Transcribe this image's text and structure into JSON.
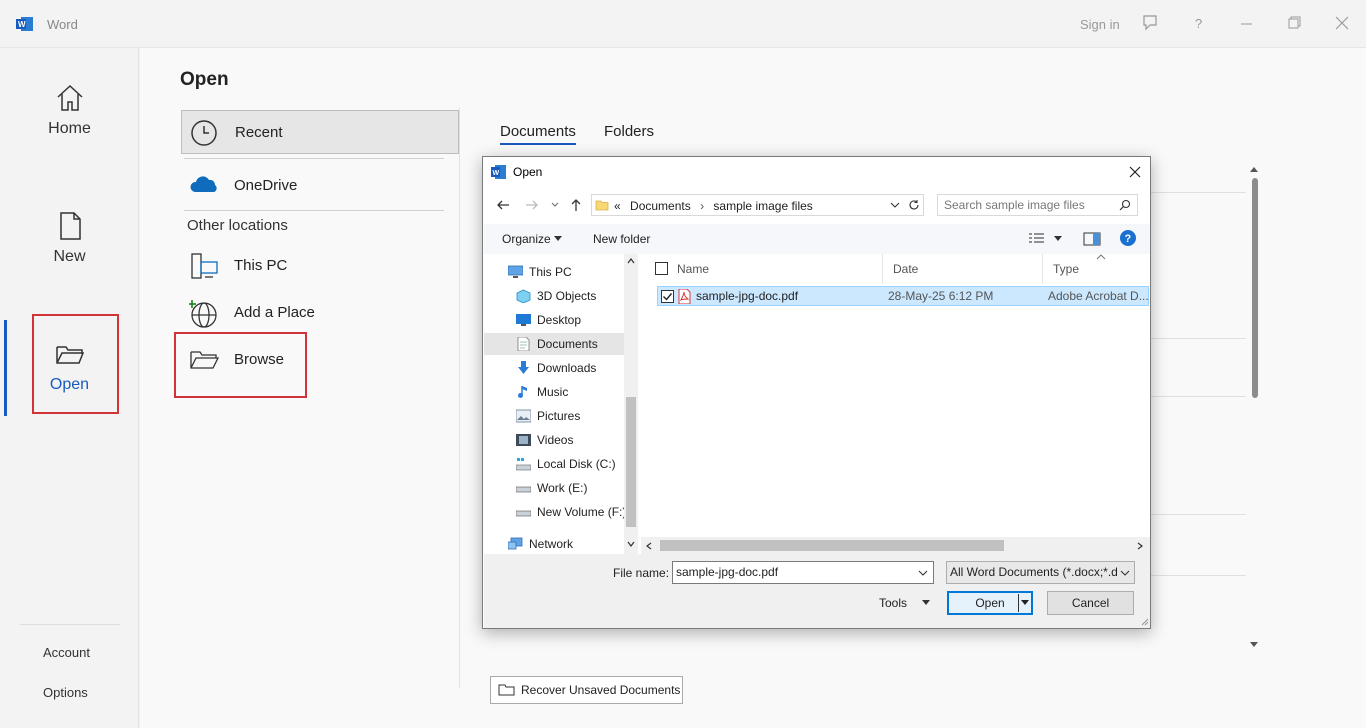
{
  "titlebar": {
    "app_title": "Word",
    "sign_in": "Sign in",
    "help": "?"
  },
  "rail": {
    "home": "Home",
    "new": "New",
    "open": "Open",
    "account": "Account",
    "options": "Options"
  },
  "main": {
    "title": "Open",
    "locations": {
      "recent": "Recent",
      "onedrive": "OneDrive",
      "other_locations": "Other locations",
      "this_pc": "This PC",
      "add_place": "Add a Place",
      "browse": "Browse"
    },
    "tabs": [
      "Documents",
      "Folders"
    ],
    "recover_button": "Recover Unsaved Documents"
  },
  "dialog": {
    "title": "Open",
    "address": {
      "chevron": "«",
      "crumbs": [
        "Documents",
        "sample image files"
      ]
    },
    "search_placeholder": "Search sample image files",
    "toolbar": {
      "organize": "Organize",
      "new_folder": "New folder"
    },
    "nav": [
      {
        "label": "This PC",
        "icon": "pc-icon"
      },
      {
        "label": "3D Objects",
        "icon": "cube-icon"
      },
      {
        "label": "Desktop",
        "icon": "desktop-icon"
      },
      {
        "label": "Documents",
        "icon": "document-icon"
      },
      {
        "label": "Downloads",
        "icon": "download-icon"
      },
      {
        "label": "Music",
        "icon": "music-icon"
      },
      {
        "label": "Pictures",
        "icon": "pictures-icon"
      },
      {
        "label": "Videos",
        "icon": "video-icon"
      },
      {
        "label": "Local Disk (C:)",
        "icon": "disk-icon"
      },
      {
        "label": "Work  (E:)",
        "icon": "drive-icon"
      },
      {
        "label": "New Volume (F:)",
        "icon": "drive-icon"
      },
      {
        "label": "Network",
        "icon": "network-icon"
      }
    ],
    "columns": [
      "Name",
      "Date",
      "Type"
    ],
    "files": [
      {
        "name": "sample-jpg-doc.pdf",
        "date": "28-May-25 6:12 PM",
        "type": "Adobe Acrobat D..."
      }
    ],
    "file_name_label": "File name:",
    "file_name_value": "sample-jpg-doc.pdf",
    "file_type_value": "All Word Documents (*.docx;*.d",
    "tools": "Tools",
    "open_button": "Open",
    "cancel_button": "Cancel"
  },
  "colors": {
    "accent": "#185abd",
    "highlight_red": "#d13438",
    "selection": "#cce8ff"
  }
}
